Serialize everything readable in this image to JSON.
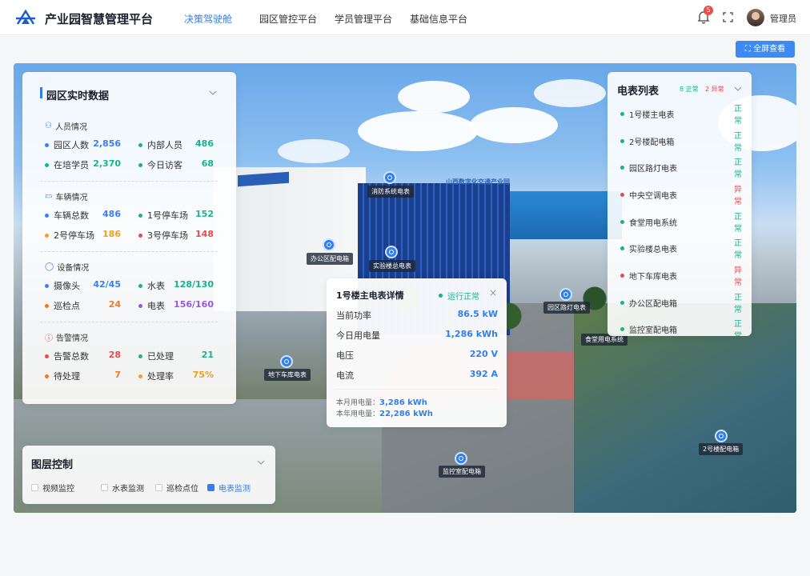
{
  "header": {
    "title": "产业园智慧管理平台",
    "nav": [
      "决策驾驶舱",
      "园区管控平台",
      "学员管理平台",
      "基础信息平台"
    ],
    "notification_count": "5",
    "user": "管理员"
  },
  "toolbar": {
    "fullscreen_label": "全屏查看"
  },
  "park_data": {
    "title": "园区实时数据",
    "people": {
      "heading": "人员情况",
      "items": [
        {
          "label": "园区人数",
          "value": "2,856",
          "color": "#3b7ff0"
        },
        {
          "label": "内部人员",
          "value": "486",
          "color": "#16b48a"
        },
        {
          "label": "在培学员",
          "value": "2,370",
          "color": "#16b48a"
        },
        {
          "label": "今日访客",
          "value": "68",
          "color": "#16b48a"
        }
      ]
    },
    "vehicles": {
      "heading": "车辆情况",
      "items": [
        {
          "label": "车辆总数",
          "value": "486",
          "color": "#3b7ff0"
        },
        {
          "label": "1号停车场",
          "value": "152",
          "color": "#16b48a"
        },
        {
          "label": "2号停车场",
          "value": "186",
          "color": "#f0a020"
        },
        {
          "label": "3号停车场",
          "value": "148",
          "color": "#e84b4b"
        }
      ]
    },
    "devices": {
      "heading": "设备情况",
      "items": [
        {
          "label": "摄像头",
          "value": "42/45",
          "color": "#3b7ff0"
        },
        {
          "label": "水表",
          "value": "128/130",
          "color": "#16b48a"
        },
        {
          "label": "巡检点",
          "value": "24",
          "color": "#f07a20"
        },
        {
          "label": "电表",
          "value": "156/160",
          "color": "#9b55e0"
        }
      ]
    },
    "alarms": {
      "heading": "告警情况",
      "items": [
        {
          "label": "告警总数",
          "value": "28",
          "color": "#e84b4b"
        },
        {
          "label": "已处理",
          "value": "21",
          "color": "#16b48a"
        },
        {
          "label": "待处理",
          "value": "7",
          "color": "#f07a20"
        },
        {
          "label": "处理率",
          "value": "75%",
          "color": "#f0a020"
        }
      ]
    }
  },
  "meter_list": {
    "title": "电表列表",
    "normal_count": "8 正常",
    "abnormal_count": "2 异常",
    "items": [
      {
        "name": "1号楼主电表",
        "status": "正常",
        "ok": true
      },
      {
        "name": "2号楼配电箱",
        "status": "正常",
        "ok": true
      },
      {
        "name": "园区路灯电表",
        "status": "正常",
        "ok": true
      },
      {
        "name": "中央空调电表",
        "status": "异常",
        "ok": false
      },
      {
        "name": "食堂用电系统",
        "status": "正常",
        "ok": true
      },
      {
        "name": "实验楼总电表",
        "status": "正常",
        "ok": true
      },
      {
        "name": "地下车库电表",
        "status": "异常",
        "ok": false
      },
      {
        "name": "办公区配电箱",
        "status": "正常",
        "ok": true
      },
      {
        "name": "监控室配电箱",
        "status": "正常",
        "ok": true
      }
    ]
  },
  "detail": {
    "title": "1号楼主电表详情",
    "status": "运行正常",
    "rows": [
      {
        "label": "当前功率",
        "value": "86.5 kW"
      },
      {
        "label": "今日用电量",
        "value": "1,286 kWh"
      },
      {
        "label": "电压",
        "value": "220 V"
      },
      {
        "label": "电流",
        "value": "392 A"
      }
    ],
    "month_label": "本月用电量：",
    "month_value": "3,286 kWh",
    "year_label": "本年用电量：",
    "year_value": "22,286 kWh"
  },
  "markers": [
    "消防系统电表",
    "办公区配电箱",
    "实验楼总电表",
    "园区路灯电表",
    "食堂用电系统",
    "地下车库电表",
    "监控室配电箱",
    "2号楼配电箱"
  ],
  "building_signs": [
    "山西数字化交通产业园"
  ],
  "layers": {
    "title": "图层控制",
    "options": [
      {
        "label": "视频监控",
        "checked": false
      },
      {
        "label": "水表监测",
        "checked": false
      },
      {
        "label": "巡检点位",
        "checked": false
      },
      {
        "label": "电表监测",
        "checked": true
      }
    ]
  }
}
